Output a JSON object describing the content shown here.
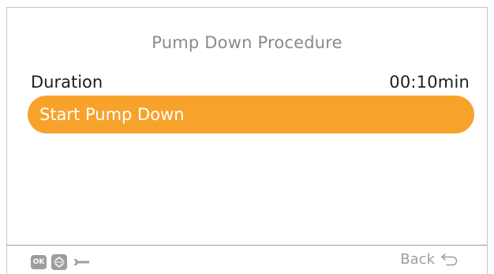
{
  "screen": {
    "title": "Pump Down Procedure"
  },
  "duration": {
    "label": "Duration",
    "value": "00:10min"
  },
  "start_button": {
    "label": "Start Pump Down"
  },
  "footer": {
    "ok_label": "OK",
    "back_label": "Back",
    "icons": [
      "ok-icon",
      "up-down-icon",
      "wrench-icon",
      "back-arrow-icon"
    ]
  },
  "colors": {
    "accent": "#f7a32b",
    "title_text": "#8a8a8a",
    "footer_icon": "#9d9d9d"
  }
}
